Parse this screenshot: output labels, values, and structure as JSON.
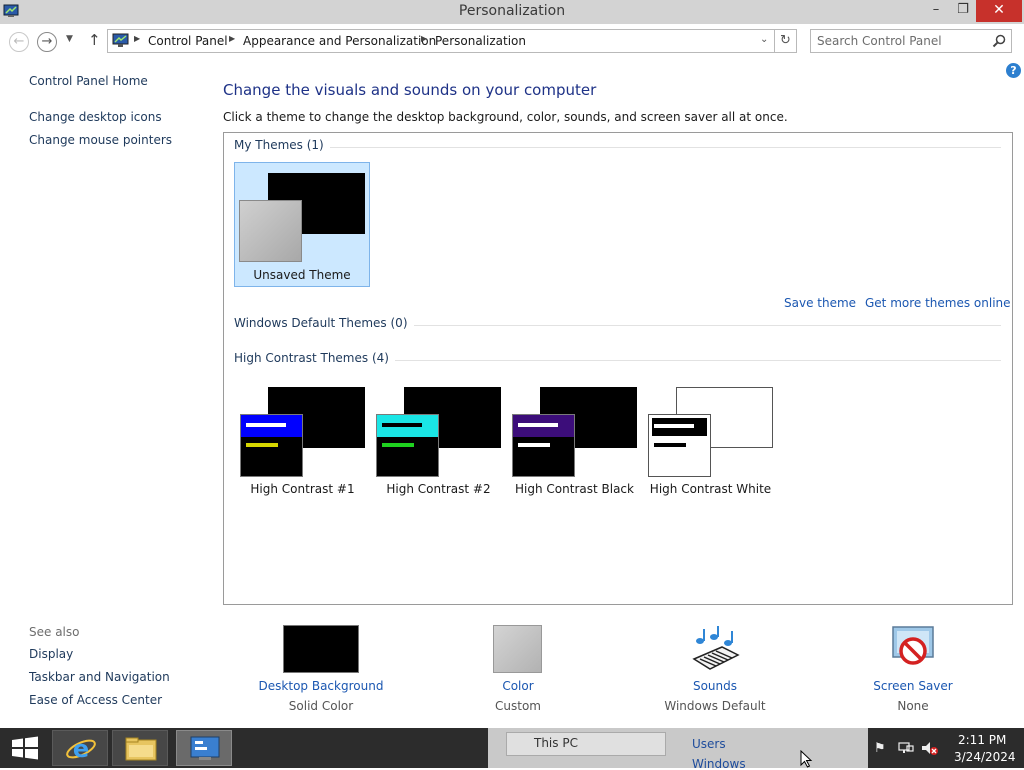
{
  "window": {
    "title": "Personalization",
    "minimize_glyph": "–",
    "maximize_glyph": "❐",
    "close_glyph": "✕"
  },
  "address_bar": {
    "back_glyph": "←",
    "forward_glyph": "→",
    "recent_glyph": "▼",
    "up_glyph": "↑",
    "refresh_glyph": "↻",
    "dropdown_glyph": "⌄",
    "breadcrumbs": [
      "Control Panel",
      "Appearance and Personalization",
      "Personalization"
    ],
    "search_placeholder": "Search Control Panel"
  },
  "left_nav": {
    "items": [
      "Control Panel Home",
      "Change desktop icons",
      "Change mouse pointers"
    ]
  },
  "help_glyph": "?",
  "main": {
    "heading": "Change the visuals and sounds on your computer",
    "subtext": "Click a theme to change the desktop background, color, sounds, and screen saver all at once.",
    "my_themes_header": "My Themes (1)",
    "unsaved_theme_label": "Unsaved Theme",
    "save_theme_link": "Save theme",
    "get_more_link": "Get more themes online",
    "windows_default_header": "Windows Default Themes (0)",
    "high_contrast_header": "High Contrast Themes (4)",
    "high_contrast_themes": [
      "High Contrast #1",
      "High Contrast #2",
      "High Contrast Black",
      "High Contrast White"
    ]
  },
  "see_also": {
    "header": "See also",
    "items": [
      "Display",
      "Taskbar and Navigation",
      "Ease of Access Center"
    ]
  },
  "settings": {
    "desktop_background": {
      "name": "Desktop Background",
      "value": "Solid Color"
    },
    "color": {
      "name": "Color",
      "value": "Custom"
    },
    "sounds": {
      "name": "Sounds",
      "value": "Windows Default"
    },
    "screen_saver": {
      "name": "Screen Saver",
      "value": "None"
    }
  },
  "taskbar": {
    "peek_items": [
      "This PC",
      "Users",
      "Windows"
    ],
    "time": "2:11 PM",
    "date": "3/24/2024"
  },
  "colors": {
    "selection_bg": "#cce8ff",
    "link_blue": "#1b57b1",
    "heading_blue": "#1e3287",
    "close_red": "#c7312b",
    "taskbar": "#2c2c2c"
  }
}
